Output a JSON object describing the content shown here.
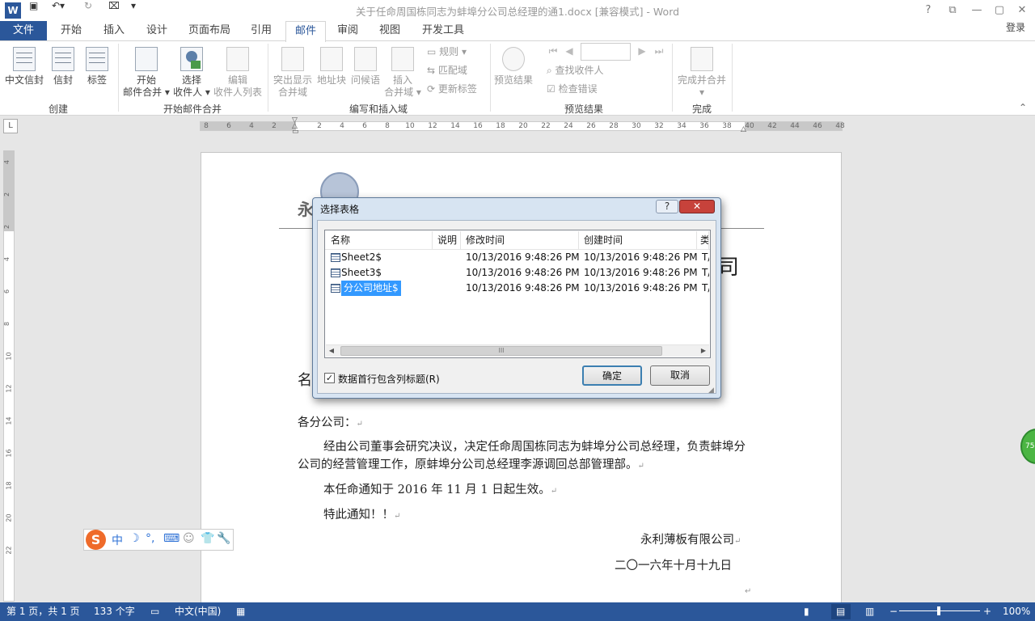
{
  "window": {
    "title": "关于任命周国栋同志为蚌埠分公司总经理的通1.docx [兼容模式] - Word",
    "controls": {
      "help": "?",
      "restore_ribbon": "⧉",
      "minimize": "—",
      "maximize": "▢",
      "close": "✕"
    }
  },
  "quick_access": {
    "word_icon": "W",
    "save_icon": "save-icon",
    "undo_icon": "undo-icon",
    "redo_icon": "redo-icon",
    "touch_icon": "touch-icon",
    "customize": "▾"
  },
  "tabs": {
    "file": "文件",
    "items": [
      "开始",
      "插入",
      "设计",
      "页面布局",
      "引用",
      "邮件",
      "审阅",
      "视图",
      "开发工具"
    ],
    "active": "邮件",
    "login": "登录"
  },
  "ribbon": {
    "create": {
      "group": "创建",
      "buttons": [
        "中文信封",
        "信封",
        "标签"
      ]
    },
    "start_merge": {
      "group": "开始邮件合并",
      "buttons": [
        {
          "line1": "开始",
          "line2": "邮件合并 ▾"
        },
        {
          "line1": "选择",
          "line2": "收件人 ▾"
        },
        {
          "line1": "编辑",
          "line2": "收件人列表"
        }
      ]
    },
    "write_insert": {
      "group": "编写和插入域",
      "buttons": [
        {
          "line1": "突出显示",
          "line2": "合并域"
        },
        {
          "line1": "地址块",
          "line2": ""
        },
        {
          "line1": "问候语",
          "line2": ""
        },
        {
          "line1": "插入",
          "line2": "合并域 ▾"
        }
      ],
      "small": [
        "规则 ▾",
        "匹配域",
        "更新标签"
      ]
    },
    "preview": {
      "group": "预览结果",
      "button": "预览结果",
      "nav": [
        "⏮",
        "◀",
        "▶",
        "⏭"
      ],
      "small": [
        "查找收件人",
        "检查错误"
      ]
    },
    "finish": {
      "group": "完成",
      "button_line1": "完成并合并",
      "button_line2": "▾"
    },
    "collapse": "⌃"
  },
  "ruler": {
    "corner": "L",
    "h_numbers": [
      "8",
      "6",
      "4",
      "2",
      "2",
      "4",
      "6",
      "8",
      "10",
      "12",
      "14",
      "16",
      "18",
      "20",
      "22",
      "24",
      "26",
      "28",
      "30",
      "32",
      "34",
      "36",
      "38",
      "40",
      "42",
      "44",
      "46",
      "48"
    ],
    "v_numbers": [
      "4",
      "2",
      "2",
      "4",
      "6",
      "8",
      "10",
      "12",
      "14",
      "16",
      "18",
      "20",
      "22"
    ]
  },
  "document": {
    "header_left": "永",
    "header_right_partial": "司",
    "side_label": "名",
    "greeting": "各分公司：",
    "para1": "经由公司董事会研究决议，决定任命周国栋同志为蚌埠分公司总经理，负责蚌埠分公司的经营管理工作，原蚌埠分公司总经理李源调回总部管理部。",
    "para2": "本任命通知于 2016 年 11 月 1 日起生效。",
    "para3": "特此通知！！",
    "company": "永利薄板有限公司",
    "date": "二〇一六年十月十九日",
    "return_mark": "↵"
  },
  "dialog": {
    "title": "选择表格",
    "help": "?",
    "close": "✕",
    "columns": [
      "名称",
      "说明",
      "修改时间",
      "创建时间",
      "类"
    ],
    "rows": [
      {
        "name": "Sheet2$",
        "desc": "",
        "modified": "10/13/2016 9:48:26 PM",
        "created": "10/13/2016 9:48:26 PM",
        "type": "T/"
      },
      {
        "name": "Sheet3$",
        "desc": "",
        "modified": "10/13/2016 9:48:26 PM",
        "created": "10/13/2016 9:48:26 PM",
        "type": "T/"
      },
      {
        "name": "分公司地址$",
        "desc": "",
        "modified": "10/13/2016 9:48:26 PM",
        "created": "10/13/2016 9:48:26 PM",
        "type": "T/"
      }
    ],
    "selected_row": 2,
    "scroll_thumb": "III",
    "checkbox_label": "数据首行包含列标题(R)",
    "checkbox_checked": true,
    "ok": "确定",
    "cancel": "取消"
  },
  "ime": {
    "logo": "S",
    "items": [
      "中",
      "☽",
      "°,",
      "⌨",
      "☺",
      "👕",
      "🔧"
    ]
  },
  "statusbar": {
    "page": "第 1 页，共 1 页",
    "words": "133 个字",
    "language": "中文(中国)",
    "zoom": "100%",
    "zoom_minus": "−",
    "zoom_plus": "+",
    "green_badge": "75"
  },
  "colors": {
    "accent": "#2b579a",
    "selection": "#3399ff",
    "dialog_close": "#c7423b"
  }
}
